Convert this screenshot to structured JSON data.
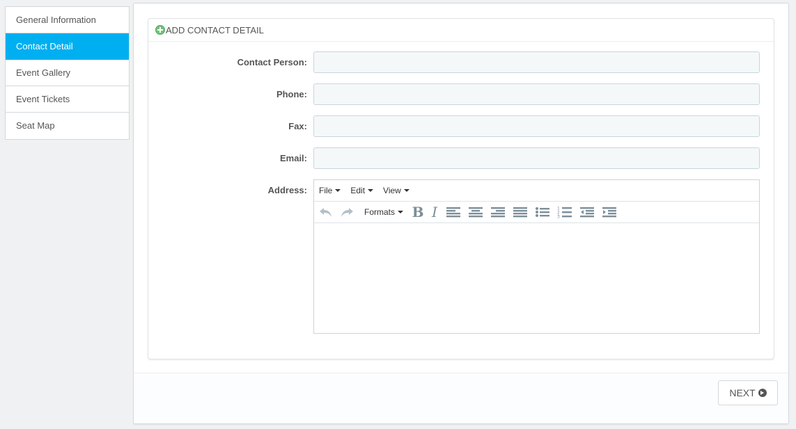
{
  "sidebar": {
    "tabs": [
      {
        "label": "General Information",
        "active": false
      },
      {
        "label": "Contact Detail",
        "active": true
      },
      {
        "label": "Event Gallery",
        "active": false
      },
      {
        "label": "Event Tickets",
        "active": false
      },
      {
        "label": "Seat Map",
        "active": false
      }
    ]
  },
  "panel": {
    "heading": "ADD CONTACT DETAIL"
  },
  "form": {
    "contact_person_label": "Contact Person:",
    "contact_person_value": "",
    "phone_label": "Phone:",
    "phone_value": "",
    "fax_label": "Fax:",
    "fax_value": "",
    "email_label": "Email:",
    "email_value": "",
    "address_label": "Address:"
  },
  "editor": {
    "menu": [
      "File",
      "Edit",
      "View"
    ],
    "formats_label": "Formats",
    "bold_glyph": "B",
    "italic_glyph": "I",
    "content": ""
  },
  "footer": {
    "next_label": "NEXT"
  },
  "colors": {
    "active_tab": "#00aff0",
    "page_bg": "#eff1f2",
    "input_bg": "#f5f8f9",
    "add_icon": "#72c279"
  }
}
